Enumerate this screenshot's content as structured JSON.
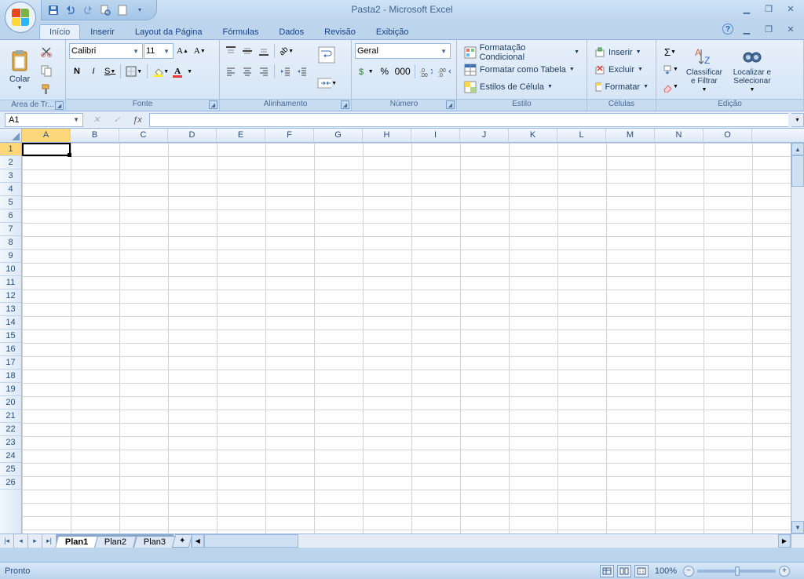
{
  "title": "Pasta2 - Microsoft Excel",
  "tabs": [
    "Início",
    "Inserir",
    "Layout da Página",
    "Fórmulas",
    "Dados",
    "Revisão",
    "Exibição"
  ],
  "active_tab": 0,
  "clipboard": {
    "label": "Área de Tr...",
    "paste": "Colar"
  },
  "font": {
    "label": "Fonte",
    "name": "Calibri",
    "size": "11"
  },
  "alignment": {
    "label": "Alinhamento"
  },
  "number": {
    "label": "Número",
    "format": "Geral"
  },
  "styles": {
    "label": "Estilo",
    "cond": "Formatação Condicional",
    "table": "Formatar como Tabela",
    "cell": "Estilos de Célula"
  },
  "cells_group": {
    "label": "Células",
    "insert": "Inserir",
    "delete": "Excluir",
    "format": "Formatar"
  },
  "editing": {
    "label": "Edição",
    "sort": "Classificar e Filtrar",
    "find": "Localizar e Selecionar"
  },
  "namebox": "A1",
  "columns": [
    "A",
    "B",
    "C",
    "D",
    "E",
    "F",
    "G",
    "H",
    "I",
    "J",
    "K",
    "L",
    "M",
    "N",
    "O"
  ],
  "rows": [
    "1",
    "2",
    "3",
    "4",
    "5",
    "6",
    "7",
    "8",
    "9",
    "10",
    "11",
    "12",
    "13",
    "14",
    "15",
    "16",
    "17",
    "18",
    "19",
    "20",
    "21",
    "22",
    "23",
    "24",
    "25",
    "26"
  ],
  "sheets": [
    "Plan1",
    "Plan2",
    "Plan3"
  ],
  "active_sheet": 0,
  "status": "Pronto",
  "zoom": "100%"
}
